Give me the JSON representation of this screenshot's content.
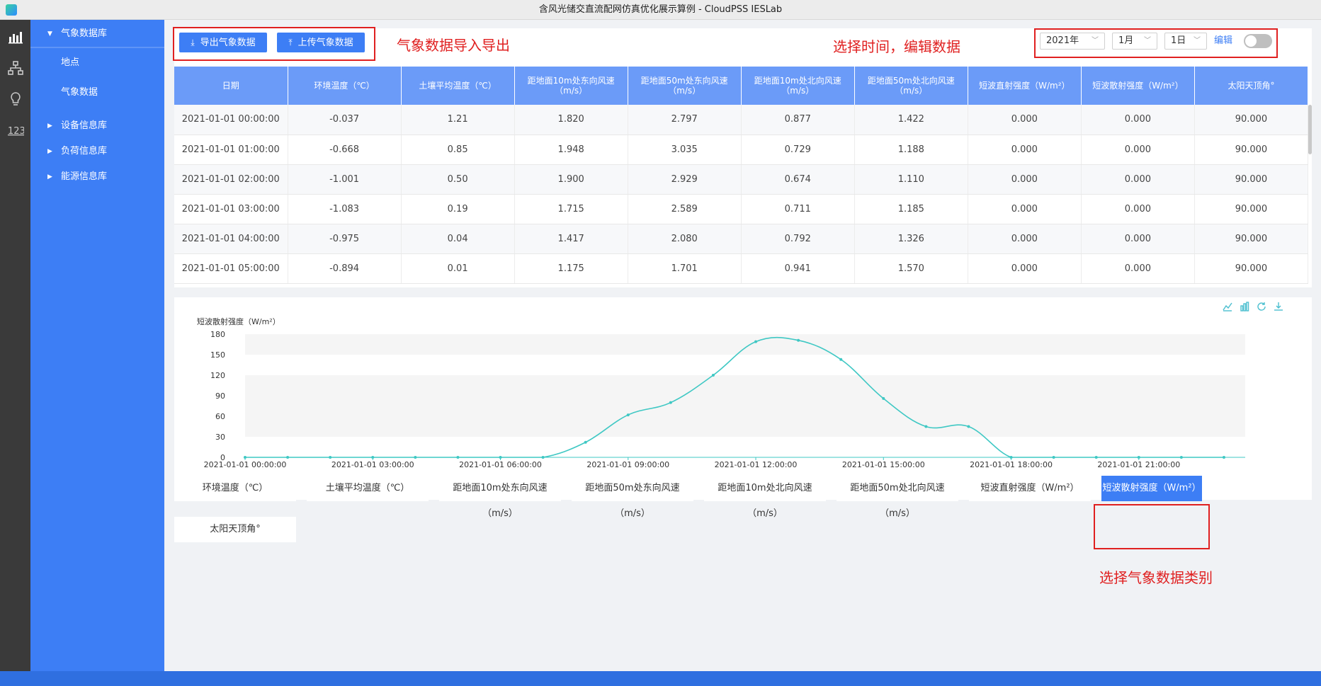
{
  "window": {
    "title": "含风光储交直流配网仿真优化展示算例 - CloudPSS IESLab"
  },
  "iconbar": {
    "items": [
      "chart-icon",
      "tree-icon",
      "bulb-icon",
      "numbers-icon"
    ]
  },
  "sidebar": {
    "group_weather": "气象数据库",
    "sub_location": "地点",
    "sub_weather": "气象数据",
    "group_device": "设备信息库",
    "group_load": "负荷信息库",
    "group_energy": "能源信息库"
  },
  "toolbar": {
    "export_label": "导出气象数据",
    "upload_label": "上传气象数据",
    "year": "2021年",
    "month": "1月",
    "day": "1日",
    "edit_label": "编辑",
    "edit_on": false
  },
  "annotations": {
    "io": "气象数据导入导出",
    "time": "选择时间，编辑数据",
    "category": "选择气象数据类别"
  },
  "table": {
    "headers": [
      "日期",
      "环境温度（℃）",
      "土壤平均温度（℃）",
      "距地面10m处东向风速（m/s）",
      "距地面50m处东向风速（m/s）",
      "距地面10m处北向风速（m/s）",
      "距地面50m处北向风速（m/s）",
      "短波直射强度（W/m²）",
      "短波散射强度（W/m²）",
      "太阳天顶角°"
    ],
    "rows": [
      [
        "2021-01-01 00:00:00",
        "-0.037",
        "1.21",
        "1.820",
        "2.797",
        "0.877",
        "1.422",
        "0.000",
        "0.000",
        "90.000"
      ],
      [
        "2021-01-01 01:00:00",
        "-0.668",
        "0.85",
        "1.948",
        "3.035",
        "0.729",
        "1.188",
        "0.000",
        "0.000",
        "90.000"
      ],
      [
        "2021-01-01 02:00:00",
        "-1.001",
        "0.50",
        "1.900",
        "2.929",
        "0.674",
        "1.110",
        "0.000",
        "0.000",
        "90.000"
      ],
      [
        "2021-01-01 03:00:00",
        "-1.083",
        "0.19",
        "1.715",
        "2.589",
        "0.711",
        "1.185",
        "0.000",
        "0.000",
        "90.000"
      ],
      [
        "2021-01-01 04:00:00",
        "-0.975",
        "0.04",
        "1.417",
        "2.080",
        "0.792",
        "1.326",
        "0.000",
        "0.000",
        "90.000"
      ],
      [
        "2021-01-01 05:00:00",
        "-0.894",
        "0.01",
        "1.175",
        "1.701",
        "0.941",
        "1.570",
        "0.000",
        "0.000",
        "90.000"
      ]
    ]
  },
  "chart_tools": [
    "line-chart-icon",
    "bar-chart-icon",
    "refresh-icon",
    "download-icon"
  ],
  "chart_data": {
    "type": "line",
    "title": "",
    "ylabel": "短波散射强度（W/m²）",
    "xlabel": "",
    "ylim": [
      0,
      180
    ],
    "yticks": [
      0,
      30,
      60,
      90,
      120,
      150,
      180
    ],
    "xtick_labels": [
      "2021-01-01 00:00:00",
      "2021-01-01 03:00:00",
      "2021-01-01 06:00:00",
      "2021-01-01 09:00:00",
      "2021-01-01 12:00:00",
      "2021-01-01 15:00:00",
      "2021-01-01 18:00:00",
      "2021-01-01 21:00:00"
    ],
    "x": [
      0,
      1,
      2,
      3,
      4,
      5,
      6,
      7,
      8,
      9,
      10,
      11,
      12,
      13,
      14,
      15,
      16,
      17,
      18,
      19,
      20,
      21,
      22,
      23
    ],
    "values": [
      0,
      0,
      0,
      0,
      0,
      0,
      0,
      0,
      22,
      62,
      80,
      120,
      169,
      171,
      143,
      86,
      45,
      45,
      0,
      0,
      0,
      0,
      0,
      0
    ],
    "color": "#3fc8c4",
    "grid": "horizontal bands"
  },
  "categories": [
    "环境温度（℃）",
    "土壤平均温度（℃）",
    "距地面10m处东向风速（m/s）",
    "距地面50m处东向风速（m/s）",
    "距地面10m处北向风速（m/s）",
    "距地面50m处北向风速（m/s）",
    "短波直射强度（W/m²）",
    "短波散射强度（W/m²）",
    "太阳天顶角°"
  ],
  "active_category": "短波散射强度（W/m²）",
  "colors": {
    "accent": "#3d7ef5",
    "annotation": "#e02020",
    "series": "#3fc8c4"
  }
}
